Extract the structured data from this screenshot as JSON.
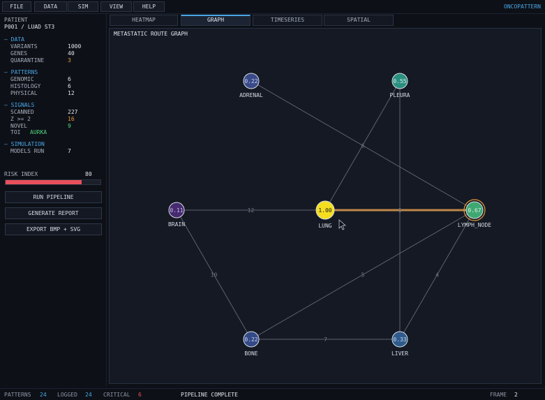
{
  "menu": {
    "items": [
      "FILE",
      "DATA",
      "SIM",
      "VIEW",
      "HELP"
    ],
    "app_name": "ONCOPATTERN"
  },
  "sidebar": {
    "patient_label": "PATIENT",
    "patient_id": "P001 / LUAD ST3",
    "data": {
      "header": "– DATA",
      "variants_label": "VARIANTS",
      "variants": "1000",
      "genes_label": "GENES",
      "genes": "40",
      "quarantine_label": "QUARANTINE",
      "quarantine": "3"
    },
    "patterns": {
      "header": "– PATTERNS",
      "genomic_label": "GENOMIC",
      "genomic": "6",
      "histology_label": "HISTOLOGY",
      "histology": "6",
      "physical_label": "PHYSICAL",
      "physical": "12"
    },
    "signals": {
      "header": "– SIGNALS",
      "scanned_label": "SCANNED",
      "scanned": "227",
      "z_label": "Z >= 2",
      "z": "16",
      "novel_label": "NOVEL",
      "novel": "9",
      "toi_label": "TOI",
      "toi": "AURKA"
    },
    "simulation": {
      "header": "– SIMULATION",
      "models_run_label": "MODELS RUN",
      "models_run": "7"
    },
    "risk_index": {
      "label": "RISK INDEX",
      "value": "80",
      "fraction": 0.8
    },
    "buttons": {
      "run_pipeline": "RUN PIPELINE",
      "generate_report": "GENERATE REPORT",
      "export": "EXPORT BMP + SVG"
    }
  },
  "tabs": [
    {
      "label": "HEATMAP",
      "active": false
    },
    {
      "label": "GRAPH",
      "active": true
    },
    {
      "label": "TIMESERIES",
      "active": false
    },
    {
      "label": "SPATIAL",
      "active": false
    }
  ],
  "graph": {
    "title": "METASTATIC ROUTE GRAPH",
    "nodes": [
      {
        "id": "lung",
        "label": "LUNG",
        "value": "1.00",
        "color": "#f5de1f",
        "text_color": "#1a1a1a"
      },
      {
        "id": "lymph_node",
        "label": "LYMPH_NODE",
        "value": "0.67",
        "color": "#3fa872",
        "text_color": "#d8f0e0",
        "ring": "#e89a3c"
      },
      {
        "id": "adrenal",
        "label": "ADRENAL",
        "value": "0.22",
        "color": "#3a4a88",
        "text_color": "#c8d0f0"
      },
      {
        "id": "pleura",
        "label": "PLEURA",
        "value": "0.55",
        "color": "#2b8f7f",
        "text_color": "#d0eee8"
      },
      {
        "id": "brain",
        "label": "BRAIN",
        "value": "0.11",
        "color": "#462b70",
        "text_color": "#c8b8e8"
      },
      {
        "id": "bone",
        "label": "BONE",
        "value": "0.22",
        "color": "#344a86",
        "text_color": "#c8d0f0"
      },
      {
        "id": "liver",
        "label": "LIVER",
        "value": "0.33",
        "color": "#2f5a8c",
        "text_color": "#c8d8f0"
      }
    ],
    "edges": [
      {
        "from": "adrenal",
        "to": "lymph_node",
        "weight": "6",
        "highlight": false
      },
      {
        "from": "pleura",
        "to": "lung",
        "weight": "",
        "highlight": false
      },
      {
        "from": "pleura",
        "to": "liver",
        "weight": "6",
        "highlight": false
      },
      {
        "from": "brain",
        "to": "lung",
        "weight": "12",
        "highlight": false
      },
      {
        "from": "lung",
        "to": "lymph_node",
        "weight": "",
        "highlight": true
      },
      {
        "from": "brain",
        "to": "bone",
        "weight": "10",
        "highlight": false
      },
      {
        "from": "bone",
        "to": "lymph_node",
        "weight": "5",
        "highlight": false
      },
      {
        "from": "lymph_node",
        "to": "liver",
        "weight": "4",
        "highlight": false
      },
      {
        "from": "bone",
        "to": "liver",
        "weight": "7",
        "highlight": false
      }
    ],
    "edge_color": "#5c6370",
    "highlight_color": "#c08848"
  },
  "status": {
    "patterns_label": "PATTERNS",
    "patterns": "24",
    "logged_label": "LOGGED",
    "logged": "24",
    "critical_label": "CRITICAL",
    "critical": "6",
    "message": "PIPELINE COMPLETE",
    "frame_label": "FRAME",
    "frame": "2"
  }
}
